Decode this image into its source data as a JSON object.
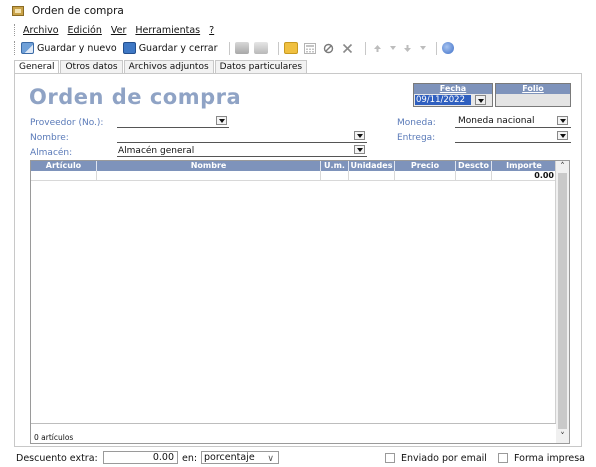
{
  "window": {
    "title": "Orden de compra"
  },
  "menu": {
    "items": [
      {
        "label": "Archivo"
      },
      {
        "label": "Edición"
      },
      {
        "label": "Ver"
      },
      {
        "label": "Herramientas"
      },
      {
        "label": "?"
      }
    ]
  },
  "toolbar": {
    "save_new_label": "Guardar y nuevo",
    "save_close_label": "Guardar y cerrar",
    "icons": [
      "print-icon",
      "print-preview-icon",
      "edit-icon",
      "calculator-icon",
      "cancel-icon",
      "delete-icon",
      "arrow-up-icon",
      "arrow-down-icon",
      "help-icon"
    ]
  },
  "tabs": [
    {
      "label": "General",
      "active": true
    },
    {
      "label": "Otros datos",
      "active": false
    },
    {
      "label": "Archivos adjuntos",
      "active": false
    },
    {
      "label": "Datos particulares",
      "active": false
    }
  ],
  "form": {
    "heading": "Orden de compra",
    "fecha_label": "Fecha",
    "fecha_value": "09/11/2022",
    "folio_label": "Folio",
    "folio_value": "",
    "proveedor_label": "Proveedor (No.):",
    "proveedor_value": "",
    "nombre_label": "Nombre:",
    "nombre_value": "",
    "almacen_label": "Almacén:",
    "almacen_value": "Almacén general",
    "moneda_label": "Moneda:",
    "moneda_value": "Moneda nacional",
    "entrega_label": "Entrega:",
    "entrega_value": ""
  },
  "grid": {
    "columns": [
      "Artículo",
      "Nombre",
      "U.m.",
      "Unidades",
      "Precio",
      "Descto",
      "Importe"
    ],
    "first_row_importe": "0.00",
    "item_count": "0 artículos"
  },
  "footer": {
    "descuento_label": "Descuento extra:",
    "descuento_value": "0.00",
    "en_label": "en:",
    "tipo_value": "porcentaje",
    "enviado_label": "Enviado por email",
    "forma_label": "Forma impresa"
  },
  "colors": {
    "header_blue": "#7e93bb",
    "label_blue": "#5a7ab8",
    "title_blue": "#8fa3c5",
    "selection_blue": "#2f5fbf"
  }
}
